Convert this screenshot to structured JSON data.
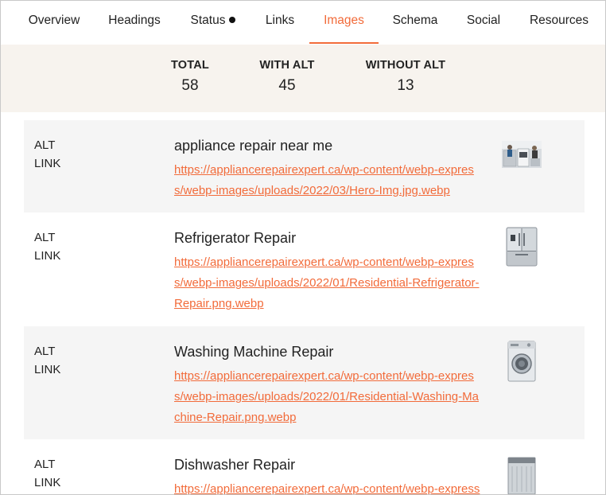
{
  "tabs": [
    {
      "label": "Overview"
    },
    {
      "label": "Headings"
    },
    {
      "label": "Status"
    },
    {
      "label": "Links"
    },
    {
      "label": "Images",
      "active": true
    },
    {
      "label": "Schema"
    },
    {
      "label": "Social"
    },
    {
      "label": "Resources"
    }
  ],
  "stats": {
    "total_label": "TOTAL",
    "total_value": "58",
    "with_alt_label": "WITH ALT",
    "with_alt_value": "45",
    "without_alt_label": "WITHOUT ALT",
    "without_alt_value": "13"
  },
  "row_labels": {
    "alt": "ALT",
    "link": "LINK"
  },
  "images": [
    {
      "alt": "appliance repair near me",
      "url": "https://appliancerepairexpert.ca/wp-content/webp-express/webp-images/uploads/2022/03/Hero-Img.jpg.webp",
      "thumb_icon": "kitchen-scene-thumbnail"
    },
    {
      "alt": "Refrigerator Repair",
      "url": "https://appliancerepairexpert.ca/wp-content/webp-express/webp-images/uploads/2022/01/Residential-Refrigerator-Repair.png.webp",
      "thumb_icon": "refrigerator-thumbnail"
    },
    {
      "alt": "Washing Machine Repair",
      "url": "https://appliancerepairexpert.ca/wp-content/webp-express/webp-images/uploads/2022/01/Residential-Washing-Machine-Repair.png.webp",
      "thumb_icon": "washing-machine-thumbnail"
    },
    {
      "alt": "Dishwasher Repair",
      "url": "https://appliancerepairexpert.ca/wp-content/webp-express",
      "thumb_icon": "dishwasher-thumbnail"
    }
  ],
  "colors": {
    "accent": "#f26b3a",
    "stats_bg": "#f7f3ee",
    "row_shade": "#f5f5f5"
  }
}
